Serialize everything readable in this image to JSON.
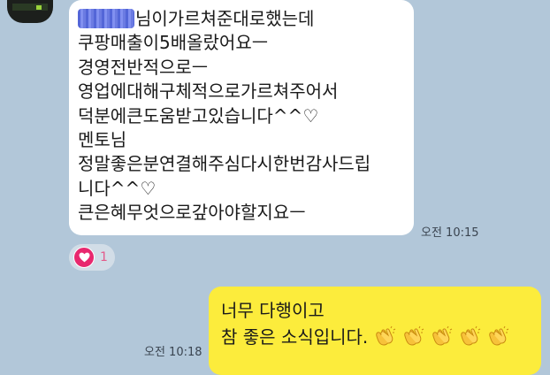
{
  "incoming": {
    "lines": [
      "님이가르쳐준대로했는데",
      "쿠팡매출이5배올랐어요ㅡ",
      "경영전반적으로ㅡ",
      "영업에대해구체적으로가르쳐주어서",
      "덕분에큰도움받고있습니다^^♡",
      "멘토님",
      "정말좋은분연결해주심다시한번감사드립",
      "니다^^♡",
      "큰은혜무엇으로갚아야할지요ㅡ"
    ],
    "time": "오전 10:15",
    "reaction_count": "1"
  },
  "outgoing": {
    "lines": [
      "너무 다행이고",
      "참 좋은 소식입니다."
    ],
    "emoji": "clapping-hands",
    "emoji_count": 5,
    "time": "오전 10:18"
  },
  "colors": {
    "background": "#b2c7d9",
    "incoming_bubble": "#ffffff",
    "outgoing_bubble": "#fcec3c",
    "heart": "#e8286e"
  }
}
